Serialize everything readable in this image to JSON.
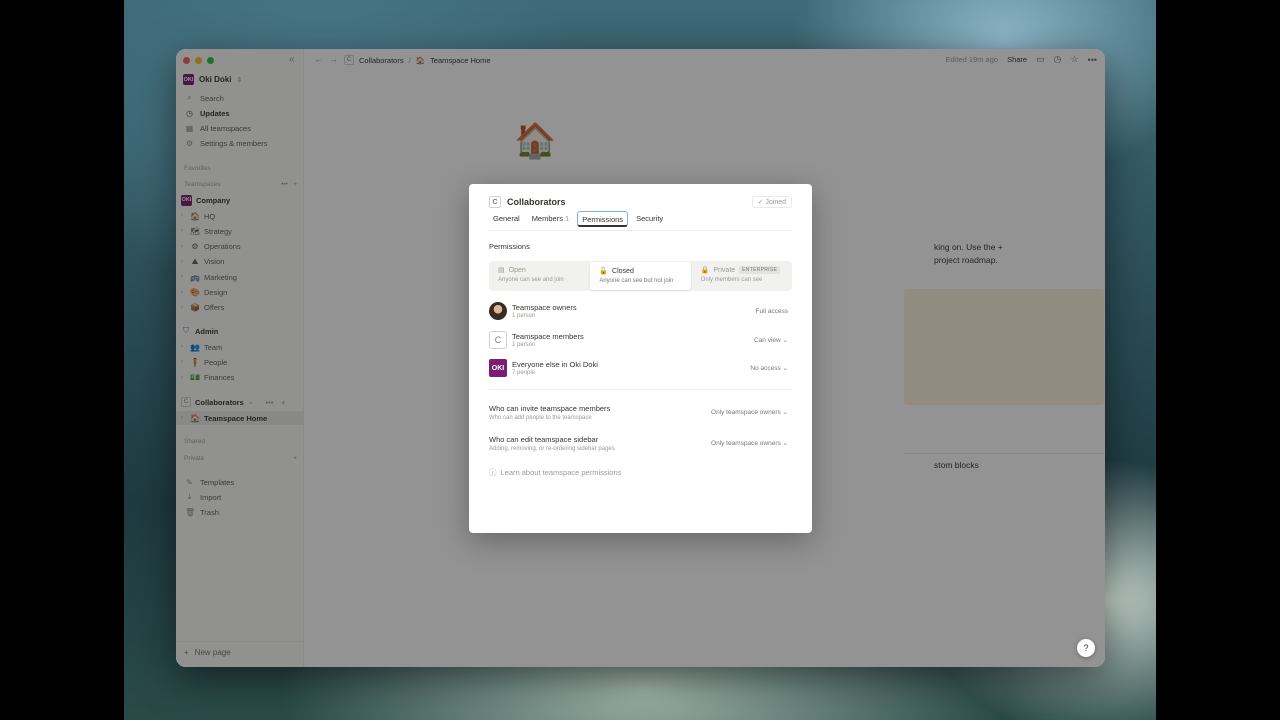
{
  "sidebar": {
    "workspace": "Oki Doki",
    "logo_text": "OKI",
    "nav": [
      {
        "icon": "⌕",
        "label": "Search"
      },
      {
        "icon": "◷",
        "label": "Updates"
      },
      {
        "icon": "▦",
        "label": "All teamspaces"
      },
      {
        "icon": "⚙",
        "label": "Settings & members"
      }
    ],
    "favorites_label": "Favorites",
    "teamspaces_label": "Teamspaces",
    "company": "Company",
    "company_pages": [
      {
        "emoji": "🏠",
        "label": "HQ"
      },
      {
        "emoji": "🗺",
        "label": "Strategy"
      },
      {
        "emoji": "⚙",
        "label": "Operations"
      },
      {
        "emoji": "⛰",
        "label": "Vision"
      },
      {
        "emoji": "🚌",
        "label": "Marketing"
      },
      {
        "emoji": "🎨",
        "label": "Design"
      },
      {
        "emoji": "📦",
        "label": "Offers"
      }
    ],
    "admin": "Admin",
    "admin_pages": [
      {
        "emoji": "👥",
        "label": "Team"
      },
      {
        "emoji": "🧍",
        "label": "People"
      },
      {
        "emoji": "💵",
        "label": "Finances"
      }
    ],
    "collaborators": "Collaborators",
    "collab_chip": "C",
    "active_page": "Teamspace Home",
    "shared_label": "Shared",
    "private_label": "Private",
    "bottom": [
      {
        "icon": "✎",
        "label": "Templates"
      },
      {
        "icon": "⤓",
        "label": "Import"
      },
      {
        "icon": "🗑",
        "label": "Trash"
      }
    ],
    "new_page": "New page"
  },
  "topbar": {
    "crumb_chip": "C",
    "crumb1": "Collaborators",
    "crumb_sep": "/",
    "crumb2": "Teamspace Home",
    "edited": "Edited 19m ago",
    "share": "Share"
  },
  "page": {
    "text1": "king on. Use the +",
    "text2": "project roadmap.",
    "text3": "stom blocks",
    "help": "?"
  },
  "modal": {
    "chip": "C",
    "title": "Collaborators",
    "joined": "✓ Joined",
    "tabs": [
      {
        "label": "General",
        "count": ""
      },
      {
        "label": "Members",
        "count": "1"
      },
      {
        "label": "Permissions",
        "count": ""
      },
      {
        "label": "Security",
        "count": ""
      }
    ],
    "section_title": "Permissions",
    "options": [
      {
        "title": "Open",
        "desc": "Anyone can see and join",
        "badge": ""
      },
      {
        "title": "Closed",
        "desc": "Anyone can see but not join",
        "badge": ""
      },
      {
        "title": "Private",
        "desc": "Only members can see",
        "badge": "ENTERPRISE"
      }
    ],
    "rows": [
      {
        "name": "Teamspace owners",
        "sub": "1 person",
        "access": "Full access"
      },
      {
        "name": "Teamspace members",
        "sub": "1 person",
        "access": "Can view ⌄"
      },
      {
        "name": "Everyone else in Oki Doki",
        "sub": "7 people",
        "access": "No access ⌄"
      }
    ],
    "settings": [
      {
        "title": "Who can invite teamspace members",
        "desc": "Who can add people to the teamspace",
        "value": "Only teamspace owners ⌄"
      },
      {
        "title": "Who can edit teamspace sidebar",
        "desc": "Adding, removing, or re-ordering sidebar pages",
        "value": "Only teamspace owners ⌄"
      }
    ],
    "learn": "Learn about teamspace permissions"
  }
}
